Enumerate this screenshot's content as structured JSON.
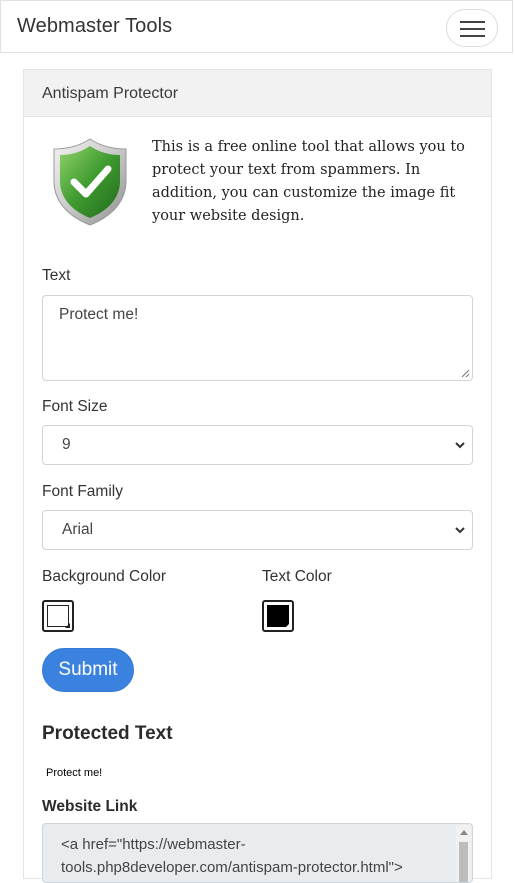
{
  "navbar": {
    "brand": "Webmaster Tools",
    "menu_icon": "hamburger-menu-icon"
  },
  "card": {
    "title": "Antispam Protector",
    "shield_icon": "shield-check-icon",
    "intro": "This is a free online tool that allows you to protect your text from spammers. In addition, you can customize the image fit your website design."
  },
  "form": {
    "text_label": "Text",
    "text_value": "Protect me!",
    "font_size_label": "Font Size",
    "font_size_value": "9",
    "font_family_label": "Font Family",
    "font_family_value": "Arial",
    "bg_color_label": "Background Color",
    "bg_color_value": "#ffffff",
    "text_color_label": "Text Color",
    "text_color_value": "#000000",
    "submit_label": "Submit"
  },
  "result": {
    "protected_heading": "Protected Text",
    "protected_text": "Protect me!",
    "website_link_heading": "Website Link",
    "website_link_code": "<a href=\"https://webmaster-tools.php8developer.com/antispam-protector.html\">"
  },
  "colors": {
    "accent": "#3b82e0",
    "shield_green": "#3f9a2f"
  }
}
